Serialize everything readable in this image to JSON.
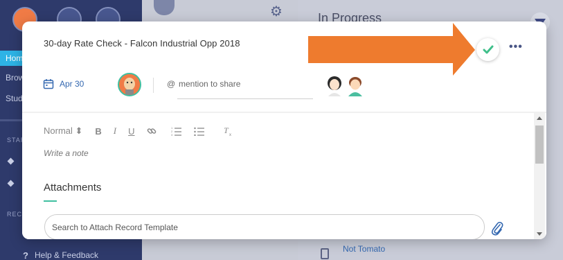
{
  "background": {
    "sidebar": {
      "nav_items": [
        "Hom",
        "Brow",
        "Stud"
      ],
      "section_labels": [
        "STAR",
        "RECE"
      ],
      "help_label": "Help & Feedback",
      "help_icon": "?"
    },
    "right_panel": {
      "title": "In Progress",
      "record_name": "Not Tomato"
    }
  },
  "modal": {
    "title": "30-day Rate Check - Falcon Industrial Opp 2018",
    "complete_icon": "check-icon",
    "more_label": "•••",
    "due_date": "Apr 30",
    "mention_symbol": "@",
    "mention_placeholder": "mention to share",
    "editor": {
      "format_label": "Normal ⬍",
      "bold": "B",
      "italic": "I",
      "underline": "U",
      "placeholder": "Write a note"
    },
    "attachments_title": "Attachments",
    "attach_search_placeholder": "Search to Attach Record Template"
  },
  "colors": {
    "accent_teal": "#3fbfa0",
    "accent_blue": "#3468b0",
    "check_green": "#3fbf8a",
    "annotation_orange": "#ee7b2e"
  }
}
